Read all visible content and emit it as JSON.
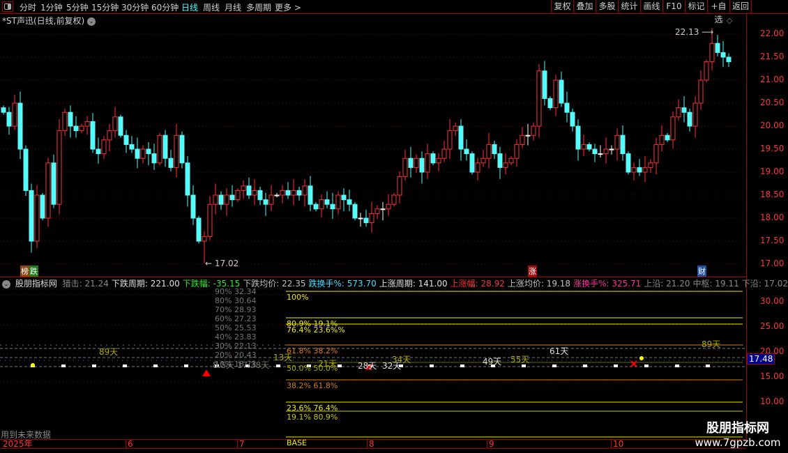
{
  "toolbar": {
    "periods": [
      "分时",
      "1分钟",
      "5分钟",
      "15分钟",
      "30分钟",
      "60分钟",
      "日线",
      "周线",
      "月线",
      "多周期",
      "更多 >"
    ],
    "active": "日线",
    "buttons": [
      "复权",
      "叠加",
      "多股",
      "统计",
      "画线",
      "F10",
      "标记",
      "+自选",
      "返回"
    ]
  },
  "title": "*ST声迅(日线,前复权)",
  "price_axis": [
    "22.00",
    "21.50",
    "21.00",
    "20.50",
    "20.00",
    "19.50",
    "19.00",
    "18.50",
    "18.00",
    "17.50",
    "17.00"
  ],
  "markers": {
    "high": "22.13",
    "low": "17.02"
  },
  "badges": {
    "b1": "榜",
    "b2": "跌",
    "b3": "涨",
    "b4": "财"
  },
  "candles_close": [
    20.3,
    20.0,
    20.5,
    19.5,
    18.6,
    17.5,
    18.5,
    18.0,
    19.2,
    18.3,
    19.9,
    20.3,
    20.0,
    19.9,
    20.0,
    20.1,
    19.5,
    19.4,
    19.7,
    19.9,
    20.2,
    19.8,
    19.6,
    19.5,
    19.3,
    19.5,
    19.4,
    19.2,
    19.8,
    19.3,
    19.1,
    19.8,
    19.2,
    18.5,
    18.0,
    17.5,
    17.6,
    18.3,
    18.5,
    18.3,
    18.5,
    18.4,
    18.6,
    18.7,
    18.5,
    18.6,
    18.4,
    18.3,
    18.5,
    18.5,
    18.6,
    18.5,
    18.6,
    18.5,
    18.7,
    18.3,
    18.2,
    18.4,
    18.3,
    18.2,
    18.5,
    18.4,
    18.3,
    18.0,
    18.0,
    17.9,
    18.1,
    18.2,
    18.2,
    18.3,
    18.5,
    18.9,
    19.3,
    19.1,
    19.3,
    19.0,
    19.4,
    19.2,
    19.3,
    19.5,
    19.9,
    20.0,
    19.5,
    19.4,
    19.0,
    19.2,
    19.3,
    19.6,
    19.4,
    19.1,
    19.2,
    19.3,
    19.6,
    19.8,
    19.8,
    20.0,
    21.2,
    20.6,
    20.4,
    21.0,
    20.5,
    20.3,
    20.0,
    19.5,
    19.6,
    19.5,
    19.4,
    19.4,
    19.5,
    19.5,
    19.8,
    19.4,
    19.0,
    19.1,
    19.0,
    19.1,
    19.2,
    19.6,
    19.8,
    19.7,
    20.2,
    20.4,
    20.3,
    20.0,
    20.5,
    21.0,
    21.4,
    21.8,
    21.6,
    21.5,
    21.4
  ],
  "indicator": {
    "name": "股朋指标网",
    "items": [
      {
        "label": "猎击: 21.24",
        "color": "#888888"
      },
      {
        "label": "下跌周期: 221.00",
        "color": "#e0e0e0"
      },
      {
        "label": "下跌幅: -35.15",
        "color": "#22ee22"
      },
      {
        "label": "下跌均价: 22.35",
        "color": "#c0c0c0"
      },
      {
        "label": "跌换手%: 573.70",
        "color": "#44ddff"
      },
      {
        "label": "上涨周期: 141.00",
        "color": "#e0e0e0"
      },
      {
        "label": "上涨幅: 28.92",
        "color": "#ff3333"
      },
      {
        "label": "上涨均价: 19.18",
        "color": "#c0c0c0"
      },
      {
        "label": "涨换手%: 325.71",
        "color": "#ff2d9a"
      },
      {
        "label": "上沿: 21.20",
        "color": "#888888"
      },
      {
        "label": "中枢: 19.11",
        "color": "#888888"
      },
      {
        "label": "下沿: 17.02",
        "color": "#888888"
      }
    ],
    "axis": [
      "30.00",
      "25.00",
      "20.00",
      "15.00",
      "10.00"
    ],
    "current": "17.48",
    "ladder": [
      "90% 32.34",
      "80% 30.64",
      "70% 28.93",
      "60% 27.23",
      "50% 25.53",
      "40% 23.83",
      "30% 22.13",
      "20% 20.43",
      "10% 18.73"
    ],
    "fib": [
      "100%",
      "80.9%  19.1%",
      "76.4%  23.6%%",
      "61.8%  38.2%",
      "50.0%  50.0%",
      "38.2%  61.8%",
      "23.6%  76.4%",
      "19.1%  80.9%",
      "BASE"
    ],
    "days": [
      "89天",
      "13天",
      "21天",
      "28天",
      "32天",
      "34天",
      "49天",
      "55天",
      "61天",
      "89天",
      "8.5天 17.38天"
    ],
    "note": "用到未来数据"
  },
  "xaxis": [
    "2025年",
    "6",
    "7",
    "8",
    "9",
    "10"
  ],
  "watermark": {
    "name": "股朋指标网",
    "url": "www.7gpzb.com"
  }
}
